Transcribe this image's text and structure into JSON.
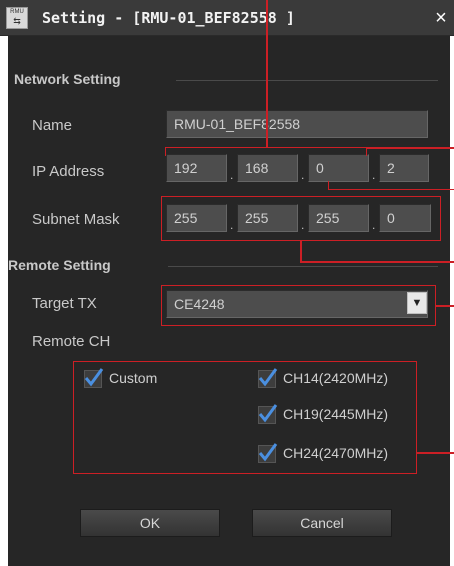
{
  "window": {
    "title": "Setting - [RMU-01_BEF82558 ]",
    "app_icon_text": "RMU",
    "close_glyph": "×"
  },
  "network": {
    "section_label": "Network Setting",
    "name_label": "Name",
    "name_value": "RMU-01_BEF82558",
    "ip_label": "IP Address",
    "ip_octets": [
      "192",
      "168",
      "0",
      "2"
    ],
    "subnet_label": "Subnet Mask",
    "subnet_octets": [
      "255",
      "255",
      "255",
      "0"
    ],
    "separator": "."
  },
  "remote": {
    "section_label": "Remote Setting",
    "target_tx_label": "Target TX",
    "target_tx_value": "CE4248",
    "dropdown_glyph": "▼",
    "remote_ch_label": "Remote CH",
    "checkboxes": [
      {
        "label": "Custom",
        "checked": true
      },
      {
        "label": "CH14(2420MHz)",
        "checked": true
      },
      {
        "label": "CH19(2445MHz)",
        "checked": true
      },
      {
        "label": "CH24(2470MHz)",
        "checked": true
      }
    ]
  },
  "buttons": {
    "ok": "OK",
    "cancel": "Cancel"
  },
  "colors": {
    "highlight": "#cc1f25",
    "check": "#4a8fe0"
  }
}
